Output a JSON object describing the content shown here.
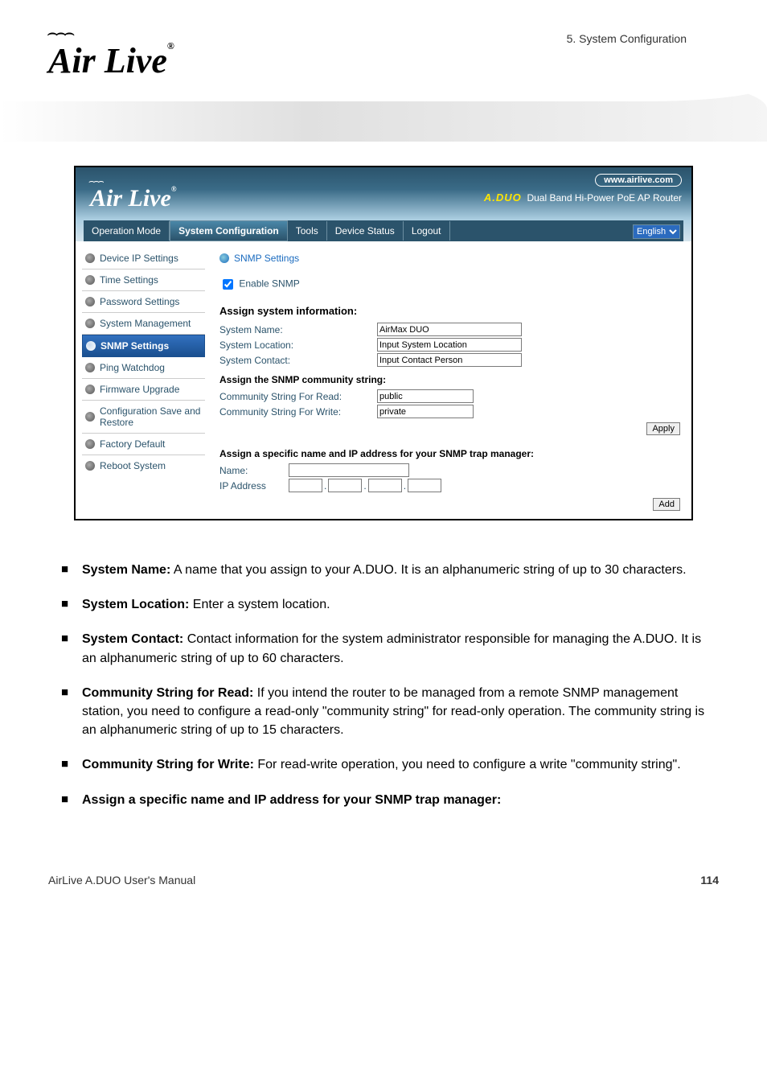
{
  "header": {
    "logo_text": "Air Live",
    "chapter": "5.  System  Configuration"
  },
  "screenshot": {
    "logo": "Air Live",
    "site_pill": "www.airlive.com",
    "product_brand": "A.DUO",
    "product_tag": "Dual Band Hi-Power PoE AP Router",
    "nav": {
      "operation_mode": "Operation Mode",
      "system_config": "System Configuration",
      "tools": "Tools",
      "device_status": "Device Status",
      "logout": "Logout",
      "language": "English"
    },
    "sidebar": {
      "device_ip": "Device IP Settings",
      "time": "Time Settings",
      "password": "Password Settings",
      "system_mgmt": "System Management",
      "snmp": "SNMP Settings",
      "ping": "Ping Watchdog",
      "firmware": "Firmware Upgrade",
      "config_save": "Configuration Save and Restore",
      "factory": "Factory Default",
      "reboot": "Reboot System"
    },
    "content": {
      "title": "SNMP Settings",
      "enable_label": "Enable SNMP",
      "assign_h": "Assign system information:",
      "sys_name_l": "System Name:",
      "sys_name_v": "AirMax DUO",
      "sys_loc_l": "System Location:",
      "sys_loc_v": "Input System Location",
      "sys_con_l": "System Contact:",
      "sys_con_v": "Input Contact Person",
      "comm_h": "Assign the SNMP community string:",
      "comm_read_l": "Community String For Read:",
      "comm_read_v": "public",
      "comm_write_l": "Community String For Write:",
      "comm_write_v": "private",
      "apply": "Apply",
      "trap_h": "Assign a specific name and IP address for your SNMP trap manager:",
      "name_l": "Name:",
      "ip_l": "IP Address",
      "add": "Add"
    }
  },
  "body": {
    "b1t": "System Name:",
    "b1": " A name that you assign to your A.DUO. It is an alphanumeric string of up to 30 characters.",
    "b2t": "System Location:",
    "b2": " Enter a system location.",
    "b3t": "System Contact:",
    "b3": " Contact information for the system administrator responsible for managing the A.DUO. It is an alphanumeric string of up to 60 characters.",
    "b4t": "Community String for Read:",
    "b4": " If you intend the router to be managed from a remote SNMP management station, you need to configure a read-only \"community string\" for read-only operation. The community string is an alphanumeric string of up to 15 characters.",
    "b5t": "Community String for Write:",
    "b5": " For read-write operation, you need to configure a write \"community string\".",
    "b6t": "Assign a specific name and IP address for your SNMP trap manager:"
  },
  "footer": {
    "manual": "AirLive A.DUO User's Manual",
    "page": "114"
  }
}
